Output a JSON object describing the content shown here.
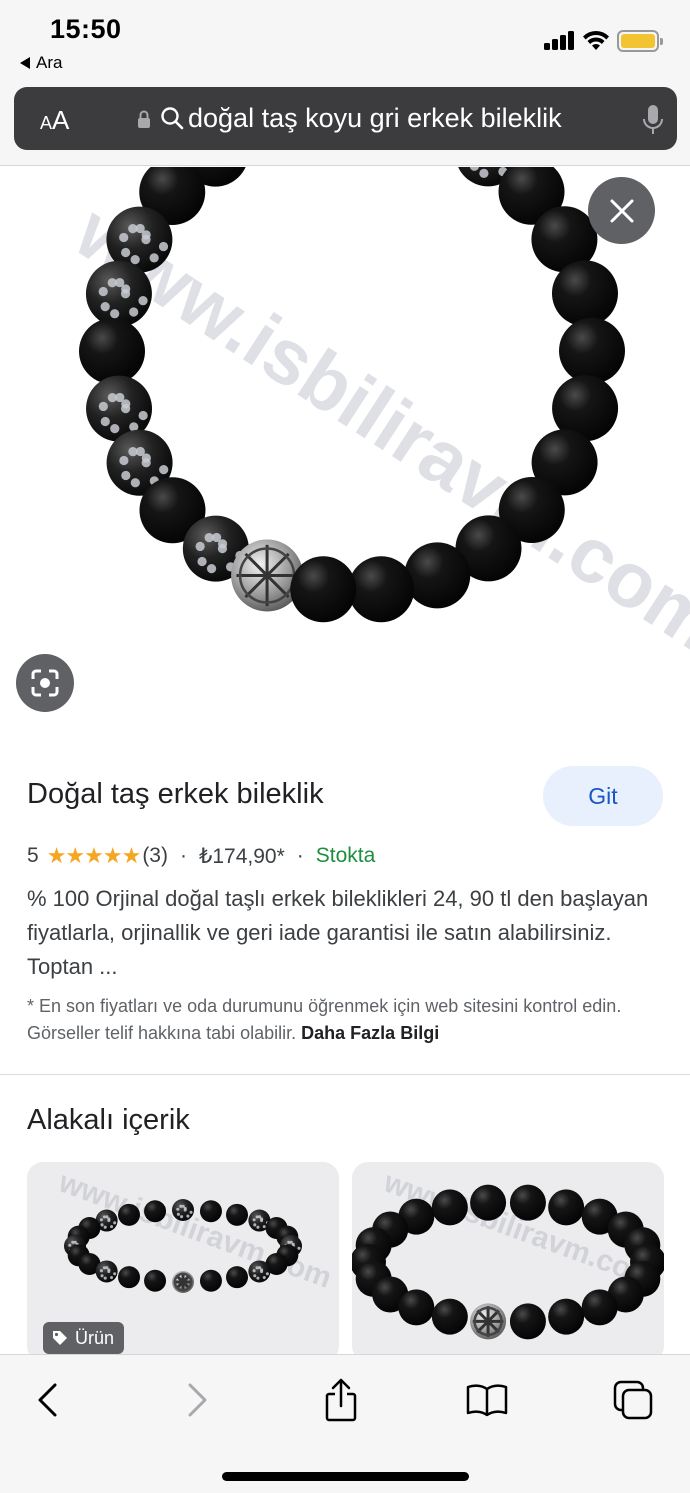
{
  "status_bar": {
    "time": "15:50",
    "back_app_label": "Ara",
    "battery_color": "#f3c431"
  },
  "address_bar": {
    "aa_small": "A",
    "aa_large": "A",
    "query": "doğal taş koyu gri erkek bileklik"
  },
  "image_viewer": {
    "watermark": "www.isbiliravm.com",
    "close_icon": "close-icon",
    "lens_icon": "lens-icon"
  },
  "product": {
    "title": "Doğal taş erkek bileklik",
    "visit_label": "Git",
    "rating": "5",
    "rating_stars": 5,
    "reviews": "(3)",
    "price": "₺174,90*",
    "stock": "Stokta",
    "description": "% 100 Orjinal doğal taşlı erkek bileklikleri 24, 90 tl den başlayan fiyatlarla, orjinallik ve geri iade garantisi ile satın alabilirsiniz. Toptan ...",
    "disclaimer": "* En son fiyatları ve oda durumunu öğrenmek için web sitesini kontrol edin. Görseller telif hakkına tabi olabilir.",
    "more_info": "Daha Fazla Bilgi",
    "colors": {
      "accent": "#1a57c4",
      "stock": "#1e8e3e",
      "stars": "#f5a623"
    }
  },
  "related": {
    "title": "Alakalı içerik",
    "cards": [
      {
        "badge": "Ürün",
        "watermark": "www.isbiliravm.com"
      },
      {
        "badge": "",
        "watermark": "www.isbiliravm.com"
      }
    ]
  },
  "toolbar": {
    "items": [
      "back-icon",
      "forward-icon",
      "share-icon",
      "bookmarks-icon",
      "tabs-icon"
    ]
  }
}
